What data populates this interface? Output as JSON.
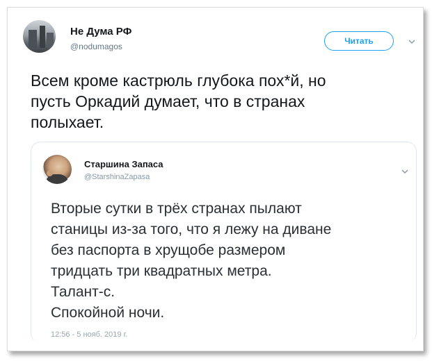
{
  "tweet": {
    "author_name": "Не Дума РФ",
    "author_handle": "@nodumagos",
    "follow_label": "Читать",
    "text_lines": [
      "Всем кроме кастрюль глубока пох*й, но",
      "пусть Оркадий думает, что в странах",
      "полыхает."
    ]
  },
  "quoted": {
    "author_name": "Старшина Запаса",
    "author_handle": "@StarshinaZapasa",
    "text_lines": [
      "Вторые сутки в трёх странах пылают",
      "станицы из-за того, что я лежу на диване",
      "без паспорта в хрущобе размером",
      "тридцать три квадратных метра.",
      "Талант-с.",
      "Спокойной ночи."
    ],
    "timestamp": "12:56 - 5 нояб. 2019 г."
  },
  "colors": {
    "accent": "#1da1f2",
    "text": "#14171a",
    "secondary": "#657786",
    "border": "#e1e8ed"
  },
  "icons": {
    "more_main": "chevron-down-icon",
    "more_quote": "chevron-down-icon"
  }
}
